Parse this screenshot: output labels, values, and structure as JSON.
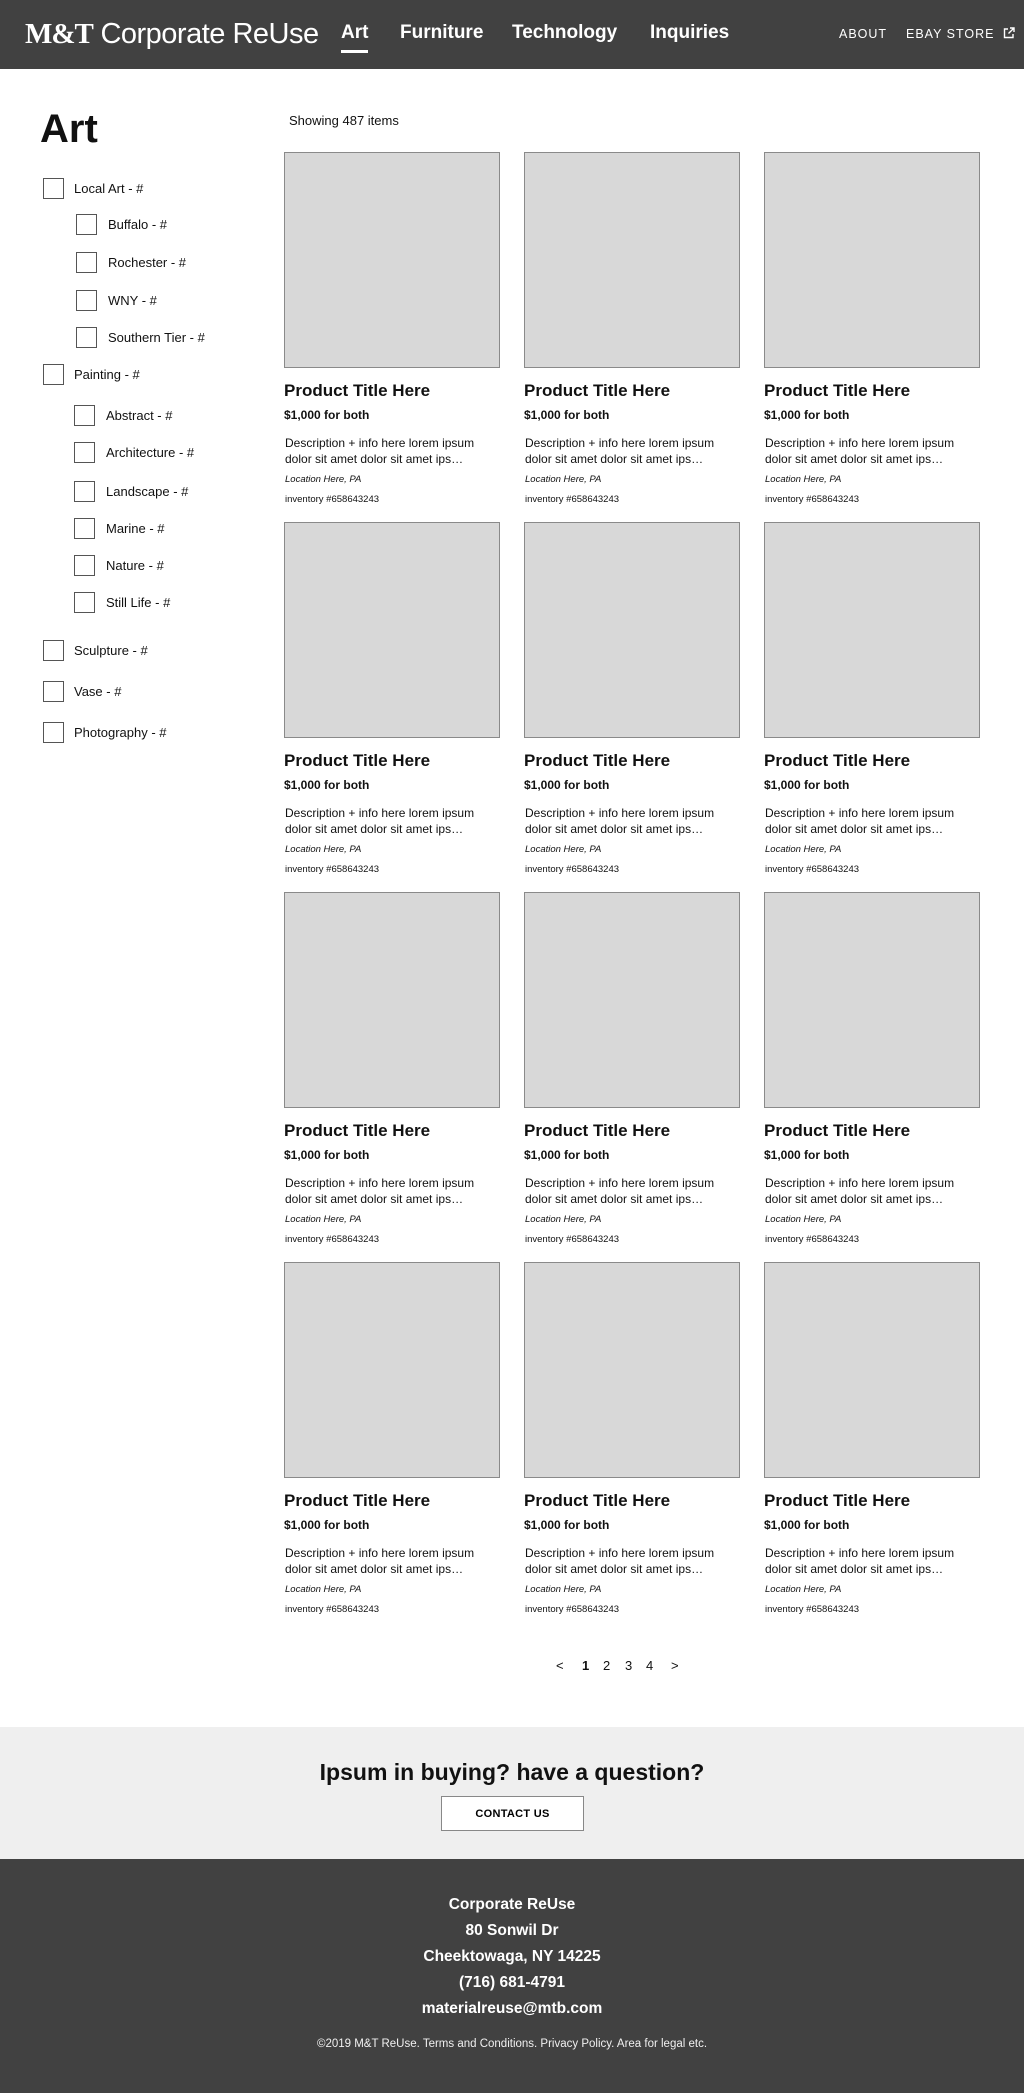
{
  "header": {
    "logo_brand": "M&T",
    "logo_rest": "Corporate ReUse",
    "nav": [
      "Art",
      "Furniture",
      "Technology",
      "Inquiries"
    ],
    "active_nav": "Art",
    "about_label": "ABOUT",
    "ebay_label": "EBAY STORE",
    "ebay_icon": "external-link-icon"
  },
  "sidebar": {
    "title": "Art",
    "filters": [
      {
        "label": "Local Art - #",
        "level": 0,
        "checked": false
      },
      {
        "label": "Buffalo - #",
        "level": 1,
        "checked": false
      },
      {
        "label": "Rochester - #",
        "level": 1,
        "checked": false
      },
      {
        "label": "WNY - #",
        "level": 1,
        "checked": false
      },
      {
        "label": "Southern Tier - #",
        "level": 1,
        "checked": false
      },
      {
        "label": "Painting - #",
        "level": 0,
        "checked": false
      },
      {
        "label": "Abstract - #",
        "level": 1,
        "checked": false
      },
      {
        "label": "Architecture - #",
        "level": 1,
        "checked": false
      },
      {
        "label": "Landscape - #",
        "level": 1,
        "checked": false
      },
      {
        "label": "Marine - #",
        "level": 1,
        "checked": false
      },
      {
        "label": "Nature - #",
        "level": 1,
        "checked": false
      },
      {
        "label": "Still Life - #",
        "level": 1,
        "checked": false
      },
      {
        "label": "Sculpture - #",
        "level": 0,
        "checked": false
      },
      {
        "label": "Vase - #",
        "level": 0,
        "checked": false
      },
      {
        "label": "Photography - #",
        "level": 0,
        "checked": false
      }
    ]
  },
  "results": {
    "count_text": "Showing 487 items",
    "products": [
      {
        "title": "Product Title Here",
        "price": "$1,000 for both",
        "description": "Description + info here lorem ipsum dolor sit amet dolor sit amet ips…",
        "location": "Location Here, PA",
        "inventory": "inventory #658643243"
      },
      {
        "title": "Product Title Here",
        "price": "$1,000 for both",
        "description": "Description + info here lorem ipsum dolor sit amet dolor sit amet ips…",
        "location": "Location Here, PA",
        "inventory": "inventory #658643243"
      },
      {
        "title": "Product Title Here",
        "price": "$1,000 for both",
        "description": "Description + info here lorem ipsum dolor sit amet dolor sit amet ips…",
        "location": "Location Here, PA",
        "inventory": "inventory #658643243"
      },
      {
        "title": "Product Title Here",
        "price": "$1,000 for both",
        "description": "Description + info here lorem ipsum dolor sit amet dolor sit amet ips…",
        "location": "Location Here, PA",
        "inventory": "inventory #658643243"
      },
      {
        "title": "Product Title Here",
        "price": "$1,000 for both",
        "description": "Description + info here lorem ipsum dolor sit amet dolor sit amet ips…",
        "location": "Location Here, PA",
        "inventory": "inventory #658643243"
      },
      {
        "title": "Product Title Here",
        "price": "$1,000 for both",
        "description": "Description + info here lorem ipsum dolor sit amet dolor sit amet ips…",
        "location": "Location Here, PA",
        "inventory": "inventory #658643243"
      },
      {
        "title": "Product Title Here",
        "price": "$1,000 for both",
        "description": "Description + info here lorem ipsum dolor sit amet dolor sit amet ips…",
        "location": "Location Here, PA",
        "inventory": "inventory #658643243"
      },
      {
        "title": "Product Title Here",
        "price": "$1,000 for both",
        "description": "Description + info here lorem ipsum dolor sit amet dolor sit amet ips…",
        "location": "Location Here, PA",
        "inventory": "inventory #658643243"
      },
      {
        "title": "Product Title Here",
        "price": "$1,000 for both",
        "description": "Description + info here lorem ipsum dolor sit amet dolor sit amet ips…",
        "location": "Location Here, PA",
        "inventory": "inventory #658643243"
      },
      {
        "title": "Product Title Here",
        "price": "$1,000 for both",
        "description": "Description + info here lorem ipsum dolor sit amet dolor sit amet ips…",
        "location": "Location Here, PA",
        "inventory": "inventory #658643243"
      },
      {
        "title": "Product Title Here",
        "price": "$1,000 for both",
        "description": "Description + info here lorem ipsum dolor sit amet dolor sit amet ips…",
        "location": "Location Here, PA",
        "inventory": "inventory #658643243"
      },
      {
        "title": "Product Title Here",
        "price": "$1,000 for both",
        "description": "Description + info here lorem ipsum dolor sit amet dolor sit amet ips…",
        "location": "Location Here, PA",
        "inventory": "inventory #658643243"
      }
    ]
  },
  "pagination": {
    "prev": "<",
    "pages": [
      "1",
      "2",
      "3",
      "4"
    ],
    "current": "1",
    "next": ">"
  },
  "cta": {
    "heading": "Ipsum in buying? have a question?",
    "button": "CONTACT US"
  },
  "footer": {
    "lines": [
      "Corporate ReUse",
      "80 Sonwil Dr",
      "Cheektowaga, NY 14225",
      "(716) 681-4791",
      "materialreuse@mtb.com"
    ],
    "legal": "©2019 M&T ReUse. Terms and Conditions. Privacy Policy. Area for legal etc."
  },
  "colors": {
    "header_bg": "#414141",
    "footer_bg": "#414141",
    "cta_bg": "#efefef",
    "placeholder_img": "#d8d8d8"
  }
}
